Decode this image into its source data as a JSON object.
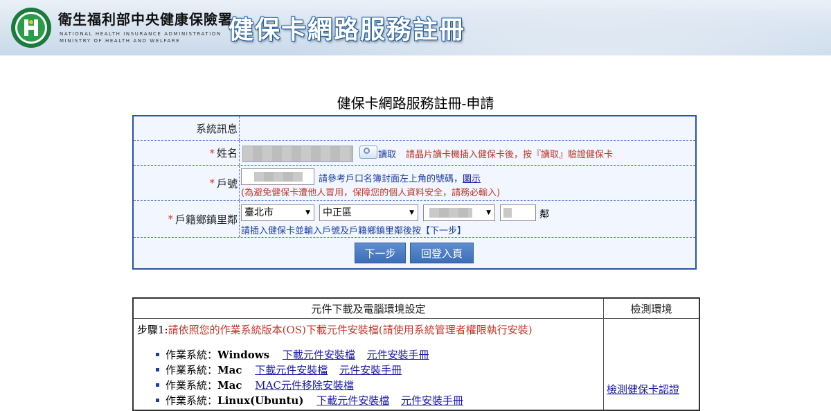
{
  "banner": {
    "agency_name_zh": "衛生福利部中央健康保險署",
    "agency_name_en_line1": "NATIONAL HEALTH INSURANCE ADMINISTRATION",
    "agency_name_en_line2": "MINISTRY OF HEALTH AND WELFARE",
    "site_title": "健保卡網路服務註冊"
  },
  "page_title": "健保卡網路服務註冊-申請",
  "form": {
    "rows": {
      "system_message": {
        "label": "系統訊息",
        "value": ""
      },
      "name": {
        "required_mark": "*",
        "label": "姓名",
        "read_label": "讀取",
        "hint": "請晶片讀卡機插入健保卡後，按『讀取』驗證健保卡"
      },
      "household_no": {
        "required_mark": "*",
        "label": "戶號",
        "hint": "請參考戶口名簿封面左上角的號碼，",
        "hint_link": "圖示",
        "warning": "(為避免健保卡遭他人冒用，保障您的個人資料安全，請務必輸入)"
      },
      "registry": {
        "required_mark": "*",
        "label": "戶籍鄉鎮里鄰",
        "city": "臺北市",
        "district": "中正區",
        "neighborhood_unit": "鄰",
        "hint": "請插入健保卡並輸入戶號及戶籍鄉鎮里鄰後按【下一步】"
      }
    },
    "buttons": {
      "next": "下一步",
      "home": "回登入頁"
    }
  },
  "download_table": {
    "header_left": "元件下載及電腦環境設定",
    "header_right": "檢測環境",
    "step1_prefix": "步驟1:",
    "step1_text": "請依照您的作業系統版本(OS)下載元件安裝檔(請使用系統管理者權限執行安裝)",
    "os_items": [
      {
        "label": "作業系統：",
        "os": "Windows",
        "links": [
          "下載元件安裝檔",
          "元件安裝手冊"
        ]
      },
      {
        "label": "作業系統：",
        "os": "Mac",
        "links": [
          "下載元件安裝檔",
          "元件安裝手冊"
        ]
      },
      {
        "label": "作業系統：",
        "os": "Mac",
        "links": [
          "MAC元件移除安裝檔"
        ]
      },
      {
        "label": "作業系統：",
        "os": "Linux(Ubuntu)",
        "links": [
          "下載元件安裝檔",
          "元件安裝手冊"
        ]
      }
    ],
    "check_link": "檢測健保卡認證"
  },
  "colors": {
    "form_border": "#2c4fa8",
    "form_bg": "#f1f6ff",
    "required_red": "#d9322b",
    "button_blue": "#4a7cc2",
    "link_blue": "#1a1aa6"
  },
  "icons": [
    "nhi-logo",
    "read-card-icon",
    "dropdown-arrow-icon",
    "bullet-icon"
  ]
}
